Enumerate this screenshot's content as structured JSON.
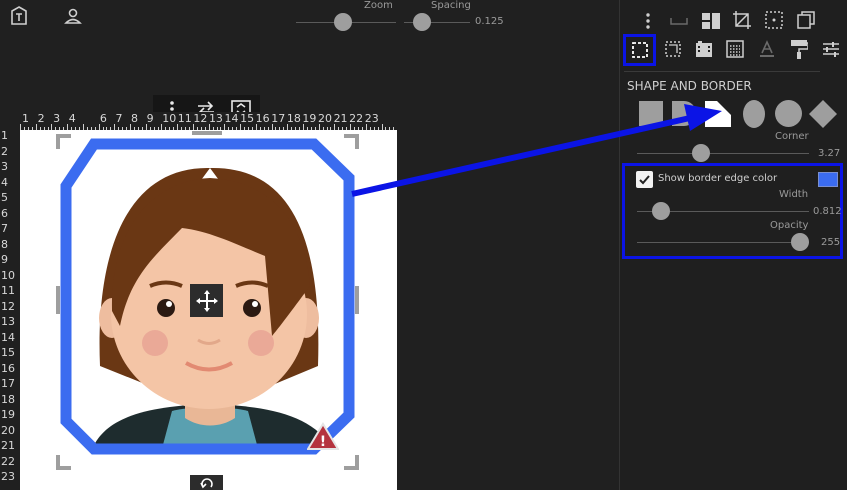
{
  "topbar": {
    "zoom_label": "Zoom",
    "spacing_label": "Spacing",
    "spacing_value": "0.125",
    "zoom_level": 0.46,
    "spacing_level": 0.19
  },
  "ruler": {
    "top_numbers": [
      "1",
      "2",
      "3",
      "4",
      "6",
      "7",
      "8",
      "9",
      "10",
      "11",
      "12",
      "13",
      "14",
      "15",
      "16",
      "17",
      "18",
      "19",
      "20",
      "21",
      "22",
      "23"
    ],
    "left_numbers": [
      "1",
      "2",
      "3",
      "4",
      "5",
      "6",
      "7",
      "8",
      "9",
      "10",
      "11",
      "12",
      "13",
      "14",
      "15",
      "16",
      "17",
      "18",
      "19",
      "20",
      "21",
      "22",
      "23"
    ]
  },
  "panel": {
    "section_title": "SHAPE AND BORDER",
    "corner_label": "Corner",
    "corner_value": "3.27",
    "corner_level": 0.36,
    "border_checkbox_label": "Show border edge color",
    "border_checked": true,
    "border_color": "#3b6cf0",
    "width_label": "Width",
    "width_value": "0.812",
    "width_level": 0.1,
    "opacity_label": "Opacity",
    "opacity_value": "255",
    "opacity_level": 1.0,
    "icons_row1": [
      "vertical-dots-icon",
      "spacer-icon",
      "layout-icon",
      "crop-icon",
      "dotted-frame-icon",
      "copy-icon"
    ],
    "icons_row2": [
      "select-frame-icon",
      "dotted-square-icon",
      "film-icon",
      "texture-icon",
      "text-color-icon",
      "paint-roller-icon",
      "sliders-icon"
    ],
    "shapes": [
      "rectangle-shape",
      "rounded-right-shape",
      "cut-corner-shape",
      "ellipse-shape",
      "circle-shape",
      "diamond-shape"
    ]
  },
  "canvas": {
    "border_color": "#3b6cf0",
    "warning": "!"
  },
  "annotation": {
    "arrow_color": "#0b14e6"
  }
}
